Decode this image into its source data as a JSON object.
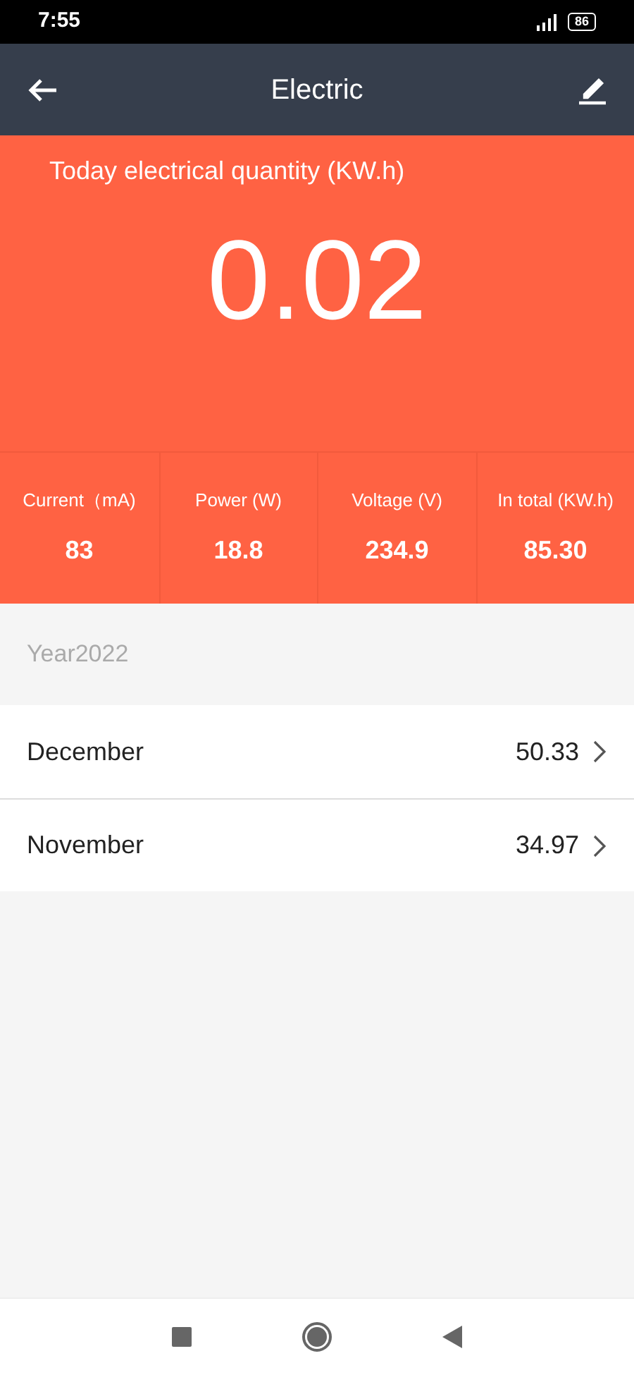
{
  "status_bar": {
    "time": "7:55",
    "battery": "86"
  },
  "header": {
    "title": "Electric"
  },
  "today": {
    "label": "Today electrical quantity (KW.h)",
    "value": "0.02"
  },
  "stats": [
    {
      "label": "Current（mA)",
      "value": "83"
    },
    {
      "label": "Power (W)",
      "value": "18.8"
    },
    {
      "label": "Voltage (V)",
      "value": "234.9"
    },
    {
      "label": "In total (KW.h)",
      "value": "85.30"
    }
  ],
  "year": "Year2022",
  "months": [
    {
      "name": "December",
      "value": "50.33"
    },
    {
      "name": "November",
      "value": "34.97"
    }
  ]
}
